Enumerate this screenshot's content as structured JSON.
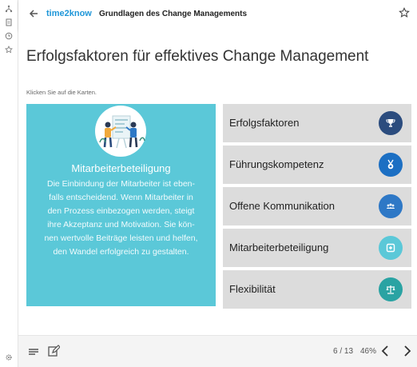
{
  "header": {
    "brand": "time2know",
    "course_title": "Grundlagen des Change Managements"
  },
  "page": {
    "heading": "Erfolgsfaktoren für effektives Change Management",
    "hint": "Klicken Sie auf die Karten."
  },
  "feature": {
    "title": "Mitarbeiterbeteiligung",
    "lines": [
      "Die Einbindung der Mitarbeiter ist eben-",
      "falls entscheidend. Wenn Mitarbeiter in",
      "den Prozess einbezogen werden, steigt",
      "ihre Akzeptanz und Motivation. Sie kön-",
      "nen wertvolle Beiträge leisten und helfen,",
      "den Wandel erfolgreich zu gestalten."
    ],
    "color": "#5bc8d8"
  },
  "tiles": [
    {
      "label": "Erfolgsfaktoren",
      "icon": "trophy-icon",
      "color": "#2b4c7e"
    },
    {
      "label": "Führungskompetenz",
      "icon": "medal-icon",
      "color": "#1c6fc3"
    },
    {
      "label": "Offene Kommunikation",
      "icon": "people-icon",
      "color": "#2e78c6"
    },
    {
      "label": "Mitarbeiterbeteiligung",
      "icon": "add-box-icon",
      "color": "#5bc8d8"
    },
    {
      "label": "Flexibilität",
      "icon": "balance-icon",
      "color": "#2aa3a3"
    }
  ],
  "footer": {
    "page_count": "6 / 13",
    "zoom": "46%"
  }
}
